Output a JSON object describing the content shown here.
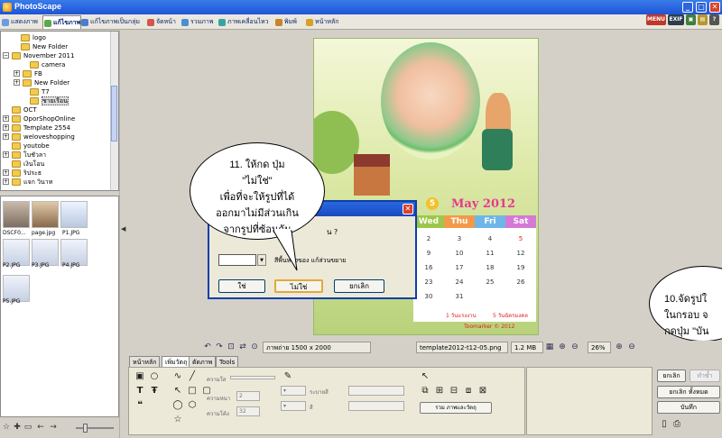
{
  "window": {
    "title": "PhotoScape",
    "minimize": "_",
    "maximize": "□",
    "close": "✕"
  },
  "tabs": [
    {
      "label": "แสดงภาพ"
    },
    {
      "label": "แก้ไขภาพ"
    },
    {
      "label": "แก้ไขภาพเป็นกลุ่ม"
    },
    {
      "label": "จัดหน้า"
    },
    {
      "label": "รวมภาพ"
    },
    {
      "label": "ภาพเคลื่อนไหว"
    },
    {
      "label": "พิมพ์"
    },
    {
      "label": "หน้าหลัก"
    }
  ],
  "toolbar_right": {
    "menu": "MENU",
    "exif": "EXIF"
  },
  "folder_tree": [
    {
      "label": "logo",
      "expander": ""
    },
    {
      "label": "New Folder",
      "expander": ""
    },
    {
      "label": "November 2011",
      "expander": "−"
    },
    {
      "label": "camera",
      "expander": ""
    },
    {
      "label": "FB",
      "expander": "+"
    },
    {
      "label": "New Folder",
      "expander": "+"
    },
    {
      "label": "T7",
      "expander": ""
    },
    {
      "label": "ชายเรือน",
      "expander": ""
    },
    {
      "label": "OCT",
      "expander": ""
    },
    {
      "label": "OporShopOnline",
      "expander": "+"
    },
    {
      "label": "Template 2554",
      "expander": "+"
    },
    {
      "label": "weloveshopping",
      "expander": "+"
    },
    {
      "label": "youtobe",
      "expander": ""
    },
    {
      "label": "โบชัวลา",
      "expander": "+"
    },
    {
      "label": "เงินโอน",
      "expander": ""
    },
    {
      "label": "ริประธ",
      "expander": "+"
    },
    {
      "label": "แจก วินาท",
      "expander": "+"
    }
  ],
  "thumbnails": [
    {
      "label": "DSCF0..."
    },
    {
      "label": "page.jpg"
    },
    {
      "label": "P1.JPG"
    },
    {
      "label": "P2.JPG"
    },
    {
      "label": "P3.JPG"
    },
    {
      "label": "P4.JPG"
    },
    {
      "label": "P5.JPG"
    }
  ],
  "calendar": {
    "month_title": "May 2012",
    "number_badge": "5",
    "headers": [
      "Wed",
      "Thu",
      "Fri",
      "Sat"
    ],
    "header_colors": [
      "#9cc84a",
      "#f29a4a",
      "#6fb6e8",
      "#d47ad6"
    ],
    "rows": [
      [
        "2",
        "3",
        "4",
        "5"
      ],
      [
        "9",
        "10",
        "11",
        "12"
      ],
      [
        "16",
        "17",
        "18",
        "19"
      ],
      [
        "23",
        "24",
        "25",
        "26"
      ],
      [
        "30",
        "31",
        "",
        ""
      ]
    ],
    "red_cells": [
      "5"
    ],
    "note1": "1 วันแรงงาน",
    "note2": "5 วันฉัตรมงคล",
    "brand": "Toomarker © 2012"
  },
  "dialog": {
    "question": "น ?",
    "fill_label": "สีพื้นหลังของ แก้ส่วนขยาย",
    "buttons": [
      "ใช่",
      "ไม่ใช่",
      "ยกเลิก"
    ],
    "close": "✕"
  },
  "bubble_left": {
    "lines": [
      "11. ให้กด ปุ่ม",
      "\"ไม่ใช่\"",
      "เพื่อที่จะให้รูปที่ได้",
      "ออกมาไม่มีส่วนเกิน",
      "จากรูปที่ซ้อนกัน"
    ]
  },
  "bubble_right": {
    "lines": [
      "10.จัดรูปใ",
      "ในกรอบ จ",
      "กดปุ่ม \"บัน"
    ]
  },
  "status": {
    "photo_size": "ภาพถ่าย 1500 x 2000",
    "filename": "template2012-t12-05.png",
    "filesize": "1.2 MB",
    "zoom": "26%"
  },
  "bottom_tabs": [
    {
      "label": "หน้าหลัก"
    },
    {
      "label": "เพิ่มวัตถุ"
    },
    {
      "label": "ตัดภาพ"
    },
    {
      "label": "Tools"
    }
  ],
  "object_panel": {
    "thickness_label": "ความหนา",
    "transparency_label": "ความใส",
    "roundness_label": "ความโค้ง",
    "thickness_value": "2",
    "roundness_value": "32",
    "border_label": "ระบายสี",
    "color_label": "สี",
    "group_button": "รวม ภาพและวัตถุ"
  },
  "actions": {
    "undo": "ยกเลิก",
    "redo": "ทำซ้ำ",
    "undo_all": "ยกเลิก ทั้งหมด",
    "save": "บันทึก"
  }
}
